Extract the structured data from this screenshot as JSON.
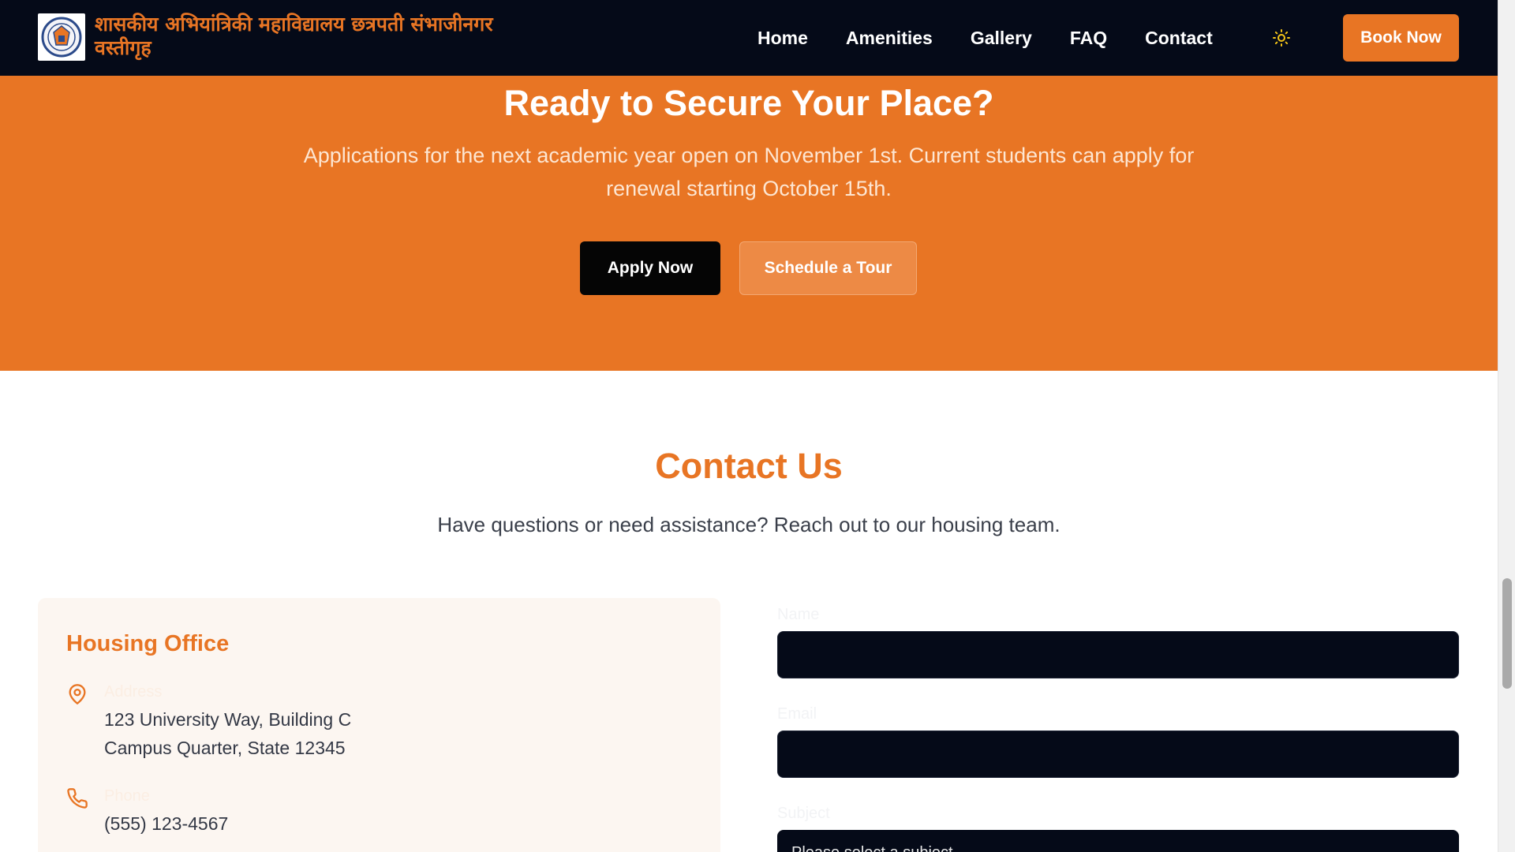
{
  "nav": {
    "brand": "शासकीय अभियांत्रिकी महाविद्यालय छत्रपती संभाजीनगर वस्तीगृह",
    "links": [
      "Home",
      "Amenities",
      "Gallery",
      "FAQ",
      "Contact"
    ],
    "book_label": "Book Now",
    "theme_icon": "sun-icon"
  },
  "hero": {
    "title": "Ready to Secure Your Place?",
    "text": "Applications for the next academic year open on November 1st. Current students can apply for renewal starting October 15th.",
    "apply_label": "Apply Now",
    "tour_label": "Schedule a Tour"
  },
  "contact": {
    "title": "Contact Us",
    "subtitle": "Have questions or need assistance? Reach out to our housing team.",
    "office": {
      "title": "Housing Office",
      "address_label": "Address",
      "address_line1": "123 University Way, Building C",
      "address_line2": "Campus Quarter, State 12345",
      "phone_label": "Phone",
      "phone": "(555) 123-4567"
    },
    "form": {
      "name_label": "Name",
      "email_label": "Email",
      "subject_label": "Subject",
      "subject_placeholder": "Please select a subject"
    }
  },
  "colors": {
    "accent": "#e87524",
    "nav_bg": "#050a18"
  }
}
